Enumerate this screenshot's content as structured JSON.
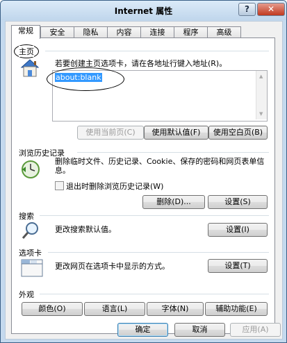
{
  "window": {
    "title": "Internet 属性",
    "help_glyph": "?",
    "close_glyph": "✕"
  },
  "tabs": [
    "常规",
    "安全",
    "隐私",
    "内容",
    "连接",
    "程序",
    "高级"
  ],
  "homepage": {
    "title": "主页",
    "description": "若要创建主页选项卡，请在各地址行键入地址(R)。",
    "address": "about:blank",
    "buttons": {
      "use_current": "使用当前页(C)",
      "use_default": "使用默认值(F)",
      "use_blank": "使用空白页(B)"
    }
  },
  "history": {
    "title": "浏览历史记录",
    "description": "删除临时文件、历史记录、Cookie、保存的密码和网页表单信息。",
    "checkbox_label": "退出时删除浏览历史记录(W)",
    "checkbox_checked": false,
    "delete_button": "删除(D)...",
    "settings_button": "设置(S)"
  },
  "search": {
    "title": "搜索",
    "description": "更改搜索默认值。",
    "settings_button": "设置(I)"
  },
  "tabs_section": {
    "title": "选项卡",
    "description": "更改网页在选项卡中显示的方式。",
    "settings_button": "设置(T)"
  },
  "appearance": {
    "title": "外观",
    "buttons": [
      "颜色(O)",
      "语言(L)",
      "字体(N)",
      "辅助功能(E)"
    ]
  },
  "footer": {
    "ok": "确定",
    "cancel": "取消",
    "apply": "应用(A)"
  },
  "colors": {
    "titlebar": "#c4d9ee",
    "selection": "#3399ff",
    "panel": "#ffffff"
  }
}
